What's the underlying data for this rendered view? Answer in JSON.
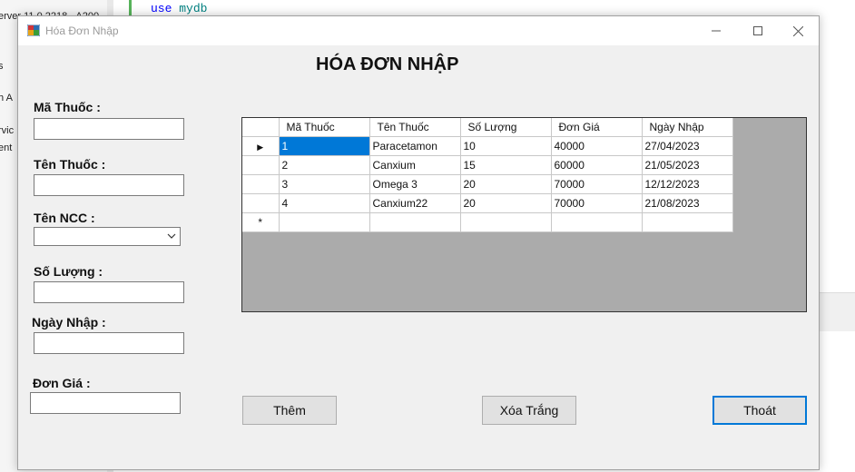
{
  "background": {
    "code_line": {
      "keyword": "use",
      "identifier": "mydb"
    },
    "fragments": [
      "erver 11.0.2218 - A200",
      "h A",
      "rvic",
      "ent",
      "s"
    ]
  },
  "window": {
    "title": "Hóa Đơn Nhập",
    "controls": {
      "minimize": "—",
      "maximize": "☐",
      "close": "✕"
    }
  },
  "form": {
    "heading": "HÓA ĐƠN NHẬP",
    "fields": {
      "ma_thuoc": {
        "label": "Mã Thuốc :",
        "value": ""
      },
      "ten_thuoc": {
        "label": "Tên Thuốc :",
        "value": ""
      },
      "ten_ncc": {
        "label": "Tên NCC :",
        "value": ""
      },
      "so_luong": {
        "label": "Số Lượng :",
        "value": ""
      },
      "ngay_nhap": {
        "label": "Ngày Nhập :",
        "value": ""
      },
      "don_gia": {
        "label": "Đơn Giá :",
        "value": ""
      }
    },
    "grid": {
      "columns": [
        "Mã Thuốc",
        "Tên Thuốc",
        "Số Lượng",
        "Đơn Giá",
        "Ngày Nhập"
      ],
      "rows": [
        [
          "1",
          "Paracetamon",
          "10",
          "40000",
          "27/04/2023"
        ],
        [
          "2",
          "Canxium",
          "15",
          "60000",
          "21/05/2023"
        ],
        [
          "3",
          "Omega 3",
          "20",
          "70000",
          "12/12/2023"
        ],
        [
          "4",
          "Canxium22",
          "20",
          "70000",
          "21/08/2023"
        ]
      ],
      "current_row_marker": "▶",
      "new_row_marker": "*"
    },
    "buttons": {
      "them": "Thêm",
      "xoa_trang": "Xóa Trắng",
      "thoat": "Thoát"
    }
  },
  "colors": {
    "selection": "#0078d7",
    "grid_background": "#ababab",
    "window_background": "#f0f0f0"
  }
}
